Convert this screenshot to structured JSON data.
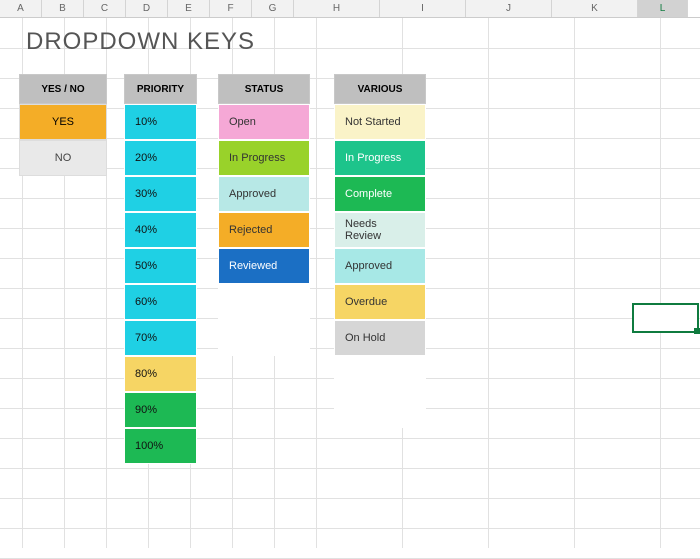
{
  "columns": [
    "A",
    "B",
    "C",
    "D",
    "E",
    "F",
    "G",
    "H",
    "I",
    "J",
    "K",
    "L"
  ],
  "title": "DROPDOWN KEYS",
  "headers": {
    "yesno": "YES / NO",
    "priority": "PRIORITY",
    "status": "STATUS",
    "various": "VARIOUS"
  },
  "yesno": [
    {
      "label": "YES",
      "bg": "#f4ad27",
      "fg": "#000"
    },
    {
      "label": "NO",
      "bg": "#e9e9e9",
      "fg": "#444"
    }
  ],
  "priority": [
    {
      "label": "10%",
      "bg": "#1fd0e4",
      "fg": "#111"
    },
    {
      "label": "20%",
      "bg": "#1fd0e4",
      "fg": "#111"
    },
    {
      "label": "30%",
      "bg": "#1fd0e4",
      "fg": "#111"
    },
    {
      "label": "40%",
      "bg": "#1fd0e4",
      "fg": "#111"
    },
    {
      "label": "50%",
      "bg": "#1fd0e4",
      "fg": "#111"
    },
    {
      "label": "60%",
      "bg": "#1fd0e4",
      "fg": "#111"
    },
    {
      "label": "70%",
      "bg": "#1fd0e4",
      "fg": "#111"
    },
    {
      "label": "80%",
      "bg": "#f6d564",
      "fg": "#111"
    },
    {
      "label": "90%",
      "bg": "#1db954",
      "fg": "#111"
    },
    {
      "label": "100%",
      "bg": "#1db954",
      "fg": "#111"
    }
  ],
  "status": [
    {
      "label": "Open",
      "bg": "#f5a8d6",
      "fg": "#333"
    },
    {
      "label": "In Progress",
      "bg": "#99d22a",
      "fg": "#333"
    },
    {
      "label": "Approved",
      "bg": "#b7e8e6",
      "fg": "#333"
    },
    {
      "label": "Rejected",
      "bg": "#f4ad27",
      "fg": "#333"
    },
    {
      "label": "Reviewed",
      "bg": "#1b6fc4",
      "fg": "#fff"
    },
    {
      "label": "",
      "bg": "#ffffff",
      "fg": "#333"
    },
    {
      "label": "",
      "bg": "#ffffff",
      "fg": "#333"
    }
  ],
  "various": [
    {
      "label": "Not Started",
      "bg": "#faf3c8",
      "fg": "#333"
    },
    {
      "label": "In Progress",
      "bg": "#1dc48b",
      "fg": "#fff"
    },
    {
      "label": "Complete",
      "bg": "#1db954",
      "fg": "#fff"
    },
    {
      "label": "Needs Review",
      "bg": "#d9efe9",
      "fg": "#333"
    },
    {
      "label": "Approved",
      "bg": "#a7e8e6",
      "fg": "#333"
    },
    {
      "label": "Overdue",
      "bg": "#f6d564",
      "fg": "#333"
    },
    {
      "label": "On Hold",
      "bg": "#d6d6d6",
      "fg": "#333"
    },
    {
      "label": "",
      "bg": "#ffffff",
      "fg": "#333"
    },
    {
      "label": "",
      "bg": "#ffffff",
      "fg": "#333"
    }
  ],
  "active_col": "L"
}
